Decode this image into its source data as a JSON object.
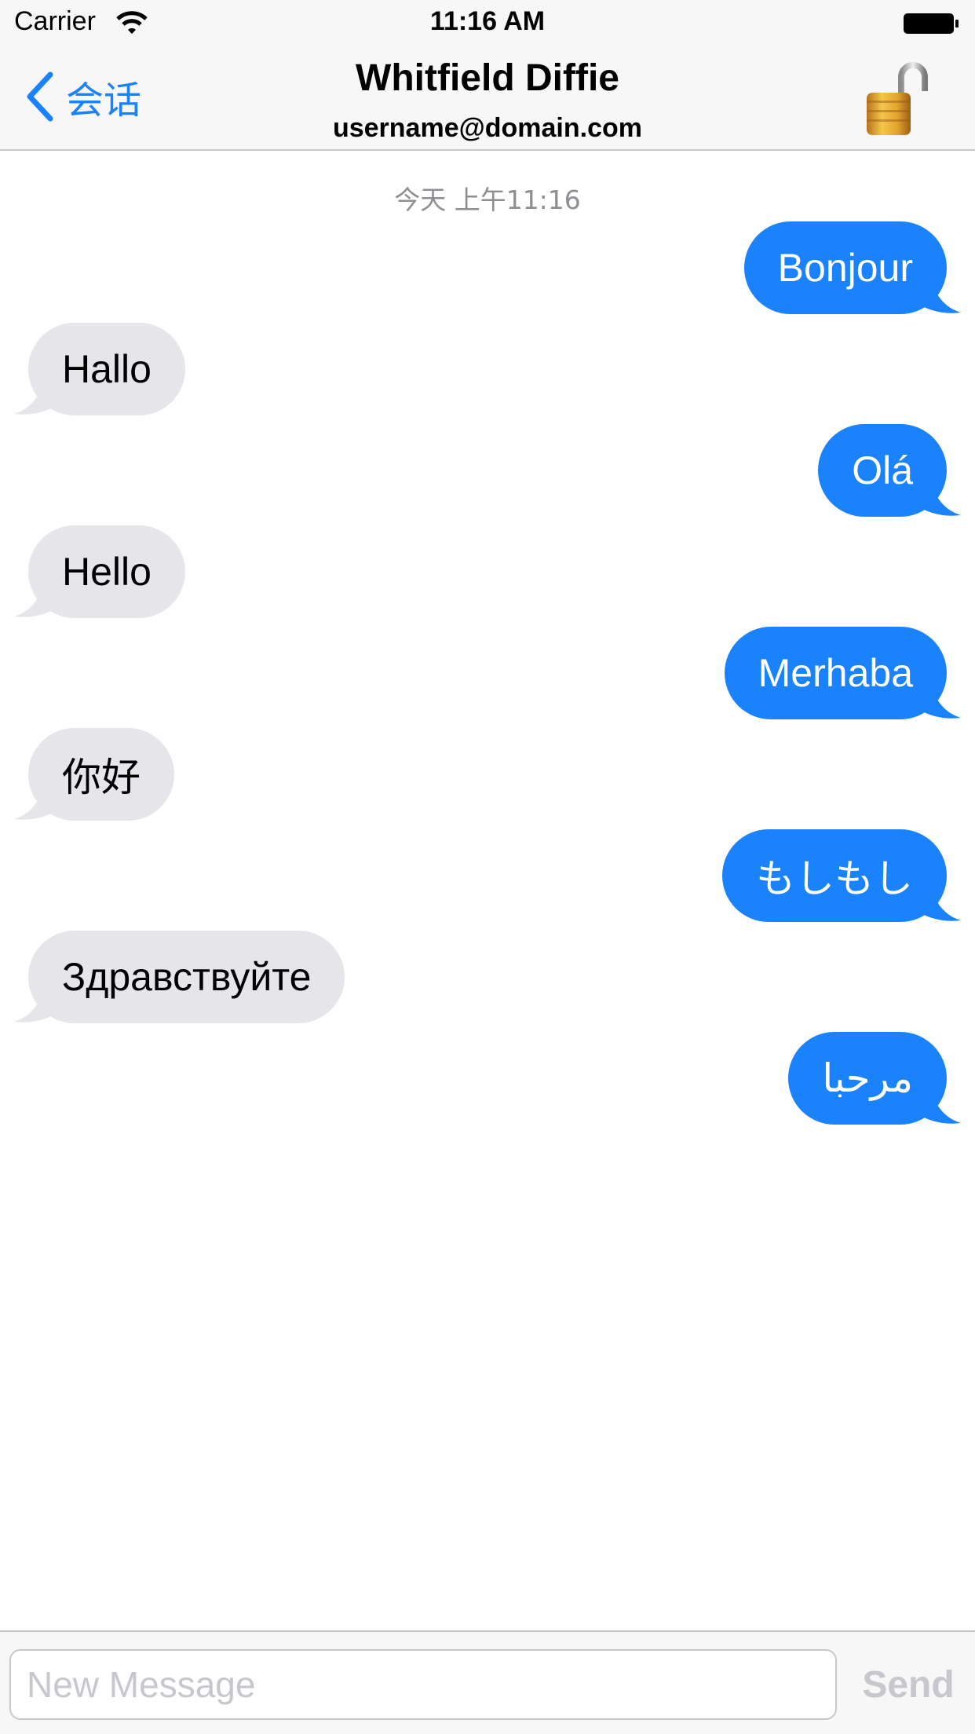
{
  "status_bar": {
    "carrier": "Carrier",
    "time": "11:16 AM"
  },
  "nav": {
    "back_label": "会话",
    "contact_name": "Whitfield Diffie",
    "contact_email": "username@domain.com",
    "lock_icon": "unlocked-padlock-icon"
  },
  "conversation": {
    "timestamp": "今天 上午11:16",
    "messages": [
      {
        "direction": "outgoing",
        "text": "Bonjour"
      },
      {
        "direction": "incoming",
        "text": "Hallo"
      },
      {
        "direction": "outgoing",
        "text": "Olá"
      },
      {
        "direction": "incoming",
        "text": "Hello"
      },
      {
        "direction": "outgoing",
        "text": "Merhaba"
      },
      {
        "direction": "incoming",
        "text": "你好"
      },
      {
        "direction": "outgoing",
        "text": "もしもし"
      },
      {
        "direction": "incoming",
        "text": "Здравствуйте"
      },
      {
        "direction": "outgoing",
        "text": "مرحبا"
      }
    ]
  },
  "composer": {
    "placeholder": "New Message",
    "send_label": "Send"
  },
  "colors": {
    "accent": "#1a82fb",
    "incoming_bubble": "#e5e5ea",
    "send_disabled": "#c7c7cd"
  }
}
